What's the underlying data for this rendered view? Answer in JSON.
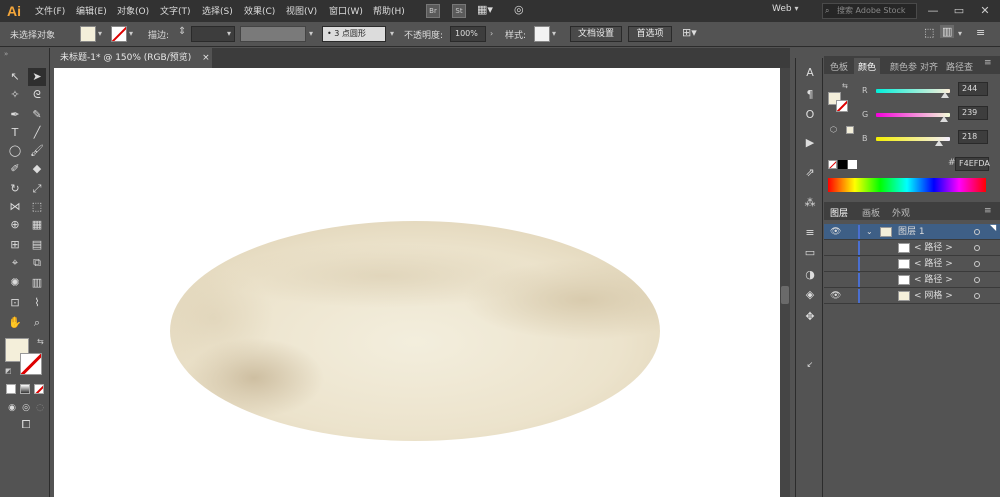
{
  "menubar": {
    "logo": "Ai",
    "items": [
      "文件(F)",
      "编辑(E)",
      "对象(O)",
      "文字(T)",
      "选择(S)",
      "效果(C)",
      "视图(V)",
      "窗口(W)",
      "帮助(H)"
    ],
    "badge_br": "Br",
    "badge_st": "St",
    "workspace": "Web",
    "search_placeholder": "搜索 Adobe Stock"
  },
  "control_bar": {
    "selection_status": "未选择对象",
    "stroke_label": "描边:",
    "brush_label": "3 点圆形",
    "opacity_label": "不透明度:",
    "opacity_value": "100%",
    "style_label": "样式:",
    "doc_setup_button": "文档设置",
    "preferences_button": "首选项"
  },
  "document_tab": {
    "title": "未标题-1* @ 150% (RGB/预览)",
    "close": "×"
  },
  "panels": {
    "color_tabs": [
      "色板",
      "颜色",
      "颜色参",
      "对齐",
      "路径查"
    ],
    "active_color_tab": "颜色",
    "r_label": "R",
    "r_value": "244",
    "g_label": "G",
    "g_value": "239",
    "b_label": "B",
    "b_value": "218",
    "hex_hash": "#",
    "hex_value": "F4EFDA",
    "layer_tabs": [
      "图层",
      "画板",
      "外观"
    ],
    "layers": [
      {
        "name": "图层 1",
        "level": 0
      },
      {
        "name": "< 路径 >",
        "level": 1
      },
      {
        "name": "< 路径 >",
        "level": 1
      },
      {
        "name": "< 路径 >",
        "level": 1
      },
      {
        "name": "< 网格 >",
        "level": 1
      }
    ]
  },
  "colors": {
    "fill": "#f4efda",
    "accent": "#4a6fd0"
  }
}
